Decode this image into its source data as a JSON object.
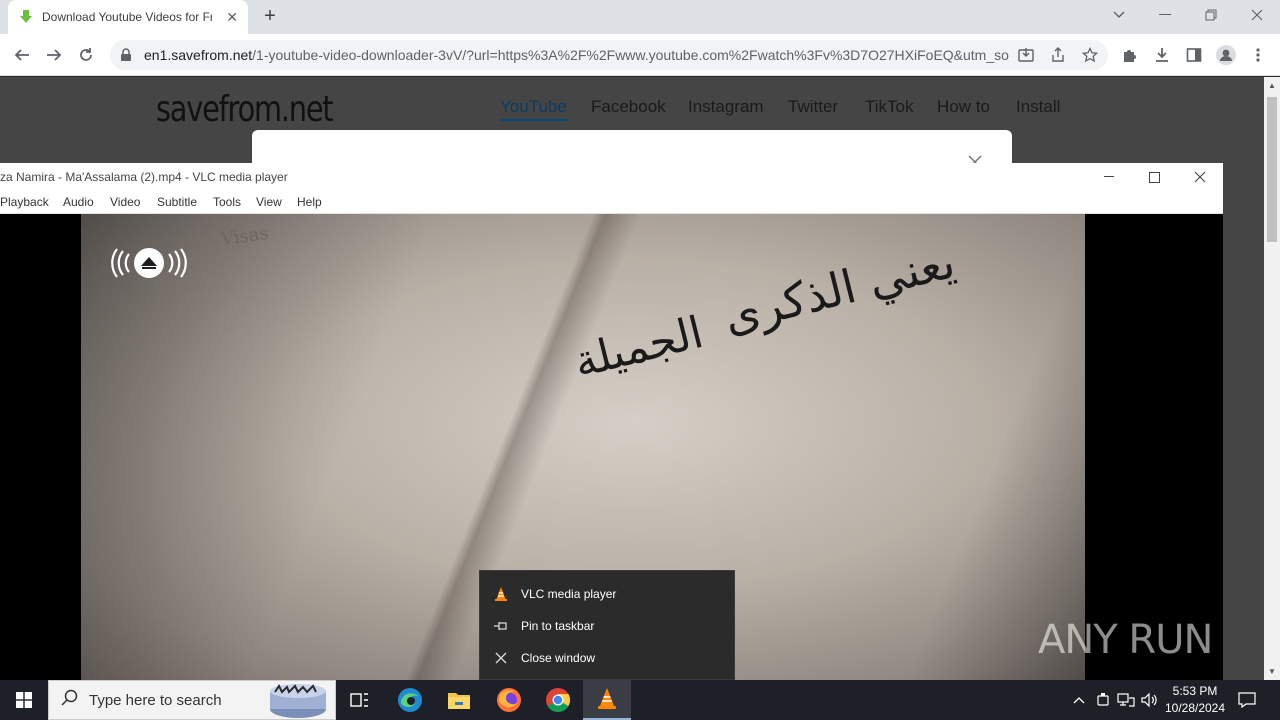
{
  "browser": {
    "tab_title": "Download Youtube Videos for Fr",
    "url_host": "en1.savefrom.net",
    "url_path": "/1-youtube-video-downloader-3vV/?url=https%3A%2F%2Fwww.youtube.com%2Fwatch%3Fv%3D7O27HXiFoEQ&utm_so..."
  },
  "site": {
    "logo": "savefrom.net",
    "nav": [
      "YouTube",
      "Facebook",
      "Instagram",
      "Twitter",
      "TikTok",
      "How to",
      "Install"
    ],
    "active_nav": "YouTube"
  },
  "vlc": {
    "title": "za Namira - Ma'Assalama  (2).mp4 - VLC media player",
    "menu": [
      "Playback",
      "Audio",
      "Video",
      "Subtitle",
      "Tools",
      "View",
      "Help"
    ],
    "video_text_line1": "يعني الذكرى",
    "video_text_line2": "الجميلة",
    "video_page_label": "Visas"
  },
  "context_menu": {
    "items": [
      {
        "label": "VLC media player",
        "icon": "vlc-cone-icon"
      },
      {
        "label": "Pin to taskbar",
        "icon": "pin-icon"
      },
      {
        "label": "Close window",
        "icon": "close-icon"
      }
    ]
  },
  "watermark": "ANY RUN",
  "taskbar": {
    "search_placeholder": "Type here to search",
    "time": "5:53 PM",
    "date": "10/28/2024"
  },
  "colors": {
    "vlc_orange": "#ff8800",
    "taskbar_bg": "#1d2026",
    "site_active_underline": "#0a4a7a"
  }
}
